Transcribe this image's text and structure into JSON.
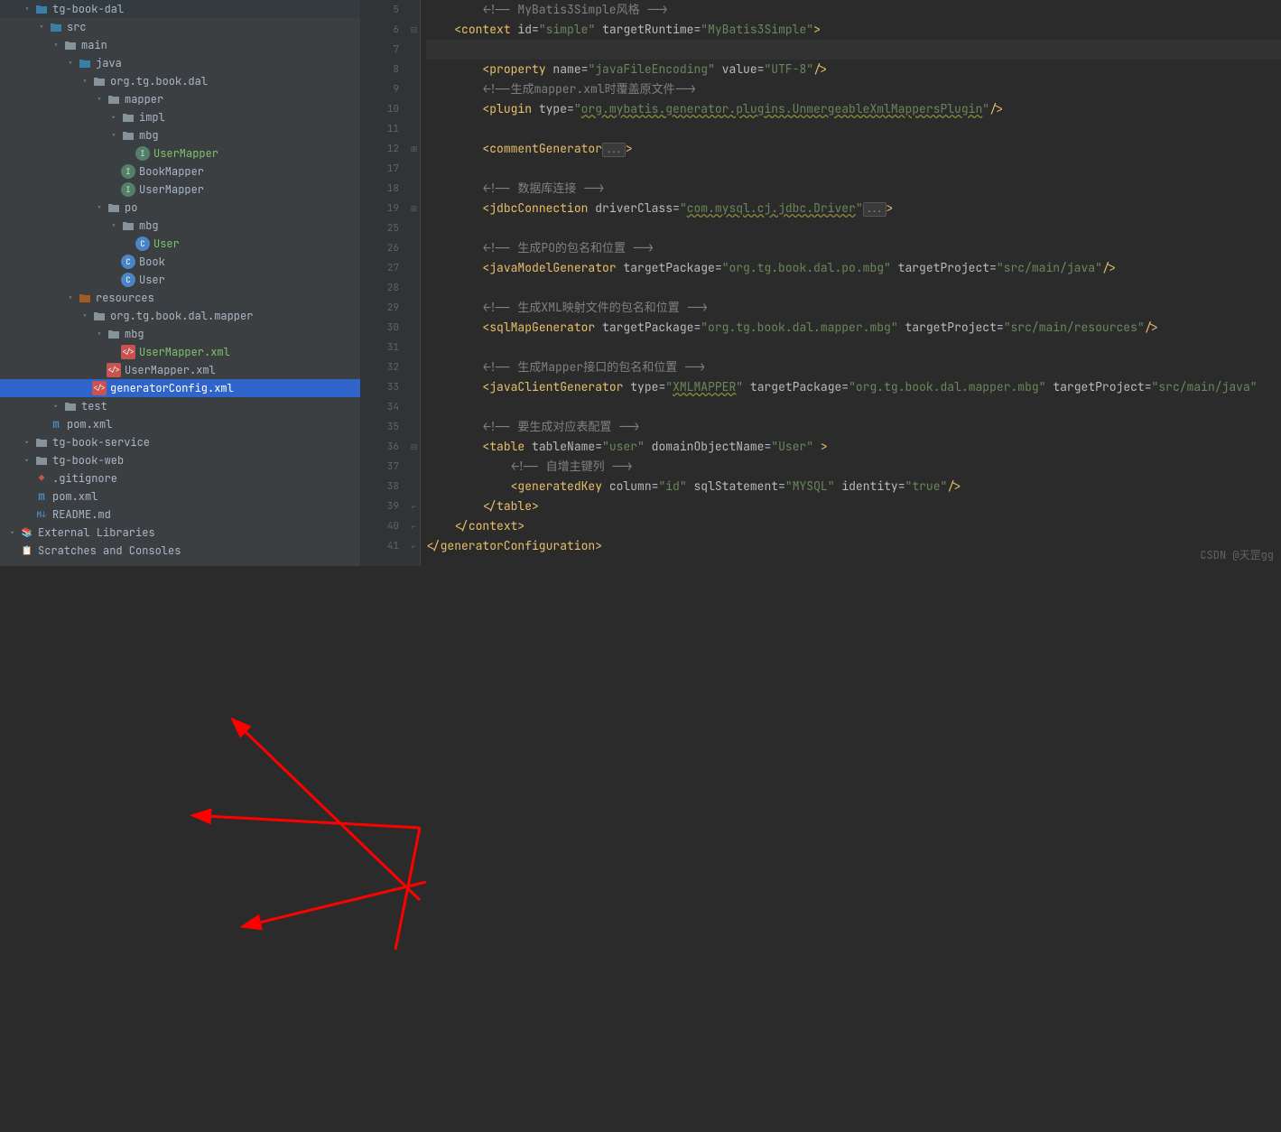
{
  "tree": [
    {
      "depth": 1,
      "arrow": "down",
      "icon": "folder-src",
      "label": "tg-book-dal",
      "cls": ""
    },
    {
      "depth": 2,
      "arrow": "down",
      "icon": "folder-src",
      "label": "src",
      "cls": ""
    },
    {
      "depth": 3,
      "arrow": "down",
      "icon": "folder",
      "label": "main",
      "cls": ""
    },
    {
      "depth": 4,
      "arrow": "down",
      "icon": "folder-src",
      "label": "java",
      "cls": ""
    },
    {
      "depth": 5,
      "arrow": "down",
      "icon": "folder-pkg",
      "label": "org.tg.book.dal",
      "cls": ""
    },
    {
      "depth": 6,
      "arrow": "down",
      "icon": "folder-pkg",
      "label": "mapper",
      "cls": ""
    },
    {
      "depth": 7,
      "arrow": "right",
      "icon": "folder-pkg",
      "label": "impl",
      "cls": ""
    },
    {
      "depth": 7,
      "arrow": "down",
      "icon": "folder-pkg",
      "label": "mbg",
      "cls": ""
    },
    {
      "depth": 8,
      "arrow": "none",
      "icon": "int",
      "label": "UserMapper",
      "cls": "green-text"
    },
    {
      "depth": 7,
      "arrow": "none",
      "icon": "int",
      "label": "BookMapper",
      "cls": ""
    },
    {
      "depth": 7,
      "arrow": "none",
      "icon": "int",
      "label": "UserMapper",
      "cls": ""
    },
    {
      "depth": 6,
      "arrow": "down",
      "icon": "folder-pkg",
      "label": "po",
      "cls": ""
    },
    {
      "depth": 7,
      "arrow": "down",
      "icon": "folder-pkg",
      "label": "mbg",
      "cls": ""
    },
    {
      "depth": 8,
      "arrow": "none",
      "icon": "java",
      "label": "User",
      "cls": "green-text"
    },
    {
      "depth": 7,
      "arrow": "none",
      "icon": "java",
      "label": "Book",
      "cls": ""
    },
    {
      "depth": 7,
      "arrow": "none",
      "icon": "java",
      "label": "User",
      "cls": ""
    },
    {
      "depth": 4,
      "arrow": "down",
      "icon": "folder-res",
      "label": "resources",
      "cls": ""
    },
    {
      "depth": 5,
      "arrow": "down",
      "icon": "folder-pkg",
      "label": "org.tg.book.dal.mapper",
      "cls": ""
    },
    {
      "depth": 6,
      "arrow": "down",
      "icon": "folder-pkg",
      "label": "mbg",
      "cls": ""
    },
    {
      "depth": 7,
      "arrow": "none",
      "icon": "xml",
      "label": "UserMapper.xml",
      "cls": "green-text"
    },
    {
      "depth": 6,
      "arrow": "none",
      "icon": "xml",
      "label": "UserMapper.xml",
      "cls": ""
    },
    {
      "depth": 5,
      "arrow": "none",
      "icon": "xml",
      "label": "generatorConfig.xml",
      "cls": "",
      "selected": true
    },
    {
      "depth": 3,
      "arrow": "right",
      "icon": "folder",
      "label": "test",
      "cls": ""
    },
    {
      "depth": 2,
      "arrow": "none",
      "icon": "maven",
      "label": "pom.xml",
      "cls": ""
    },
    {
      "depth": 1,
      "arrow": "right",
      "icon": "folder",
      "label": "tg-book-service",
      "cls": ""
    },
    {
      "depth": 1,
      "arrow": "right",
      "icon": "folder",
      "label": "tg-book-web",
      "cls": ""
    },
    {
      "depth": 1,
      "arrow": "none",
      "icon": "git",
      "label": ".gitignore",
      "cls": ""
    },
    {
      "depth": 1,
      "arrow": "none",
      "icon": "maven",
      "label": "pom.xml",
      "cls": ""
    },
    {
      "depth": 1,
      "arrow": "none",
      "icon": "md",
      "label": "README.md",
      "cls": ""
    },
    {
      "depth": 0,
      "arrow": "right",
      "icon": "lib",
      "label": "External Libraries",
      "cls": ""
    },
    {
      "depth": 0,
      "arrow": "none",
      "icon": "scratch",
      "label": "Scratches and Consoles",
      "cls": ""
    }
  ],
  "lines": [
    {
      "n": 5,
      "fold": "",
      "tokens": [
        {
          "t": "        ",
          "c": ""
        },
        {
          "t": "<!-- MyBatis3Simple风格 -->",
          "c": "c-comment"
        }
      ]
    },
    {
      "n": 6,
      "fold": "open",
      "bulb": true,
      "tokens": [
        {
          "t": "    ",
          "c": ""
        },
        {
          "t": "<",
          "c": "c-tag"
        },
        {
          "t": "context ",
          "c": "c-tag"
        },
        {
          "t": "id",
          "c": "c-attr"
        },
        {
          "t": "=",
          "c": "c-text"
        },
        {
          "t": "\"simple\"",
          "c": "c-str"
        },
        {
          "t": " ",
          "c": ""
        },
        {
          "t": "targetRuntime",
          "c": "c-attr"
        },
        {
          "t": "=",
          "c": "c-text"
        },
        {
          "t": "\"MyBatis3Simple\"",
          "c": "c-str"
        },
        {
          "t": ">",
          "c": "c-tag"
        }
      ]
    },
    {
      "n": 7,
      "fold": "",
      "cur": true,
      "tokens": [
        {
          "t": "",
          "c": ""
        }
      ]
    },
    {
      "n": 8,
      "fold": "",
      "tokens": [
        {
          "t": "        ",
          "c": ""
        },
        {
          "t": "<",
          "c": "c-tag"
        },
        {
          "t": "property ",
          "c": "c-tag"
        },
        {
          "t": "name",
          "c": "c-attr"
        },
        {
          "t": "=",
          "c": "c-text"
        },
        {
          "t": "\"javaFileEncoding\"",
          "c": "c-str"
        },
        {
          "t": " ",
          "c": ""
        },
        {
          "t": "value",
          "c": "c-attr"
        },
        {
          "t": "=",
          "c": "c-text"
        },
        {
          "t": "\"UTF-8\"",
          "c": "c-str"
        },
        {
          "t": "/>",
          "c": "c-tag"
        }
      ]
    },
    {
      "n": 9,
      "fold": "",
      "tokens": [
        {
          "t": "        ",
          "c": ""
        },
        {
          "t": "<!--生成mapper.xml时覆盖原文件-->",
          "c": "c-comment"
        }
      ]
    },
    {
      "n": 10,
      "fold": "",
      "tokens": [
        {
          "t": "        ",
          "c": ""
        },
        {
          "t": "<",
          "c": "c-tag"
        },
        {
          "t": "plugin ",
          "c": "c-tag"
        },
        {
          "t": "type",
          "c": "c-attr"
        },
        {
          "t": "=",
          "c": "c-text"
        },
        {
          "t": "\"",
          "c": "c-str"
        },
        {
          "t": "org.mybatis.generator.plugins.UnmergeableXmlMappersPlugin",
          "c": "c-str c-warn"
        },
        {
          "t": "\"",
          "c": "c-str"
        },
        {
          "t": "/>",
          "c": "c-tag"
        }
      ]
    },
    {
      "n": 11,
      "fold": "",
      "tokens": [
        {
          "t": "",
          "c": ""
        }
      ]
    },
    {
      "n": 12,
      "fold": "closed",
      "tokens": [
        {
          "t": "        ",
          "c": ""
        },
        {
          "t": "<",
          "c": "c-tag"
        },
        {
          "t": "commentGenerator",
          "c": "c-tag"
        },
        {
          "t": "...",
          "c": "c-fold"
        },
        {
          "t": ">",
          "c": "c-tag"
        }
      ]
    },
    {
      "n": 17,
      "fold": "",
      "tokens": [
        {
          "t": "",
          "c": ""
        }
      ]
    },
    {
      "n": 18,
      "fold": "",
      "tokens": [
        {
          "t": "        ",
          "c": ""
        },
        {
          "t": "<!-- 数据库连接 -->",
          "c": "c-comment"
        }
      ]
    },
    {
      "n": 19,
      "fold": "closed",
      "tokens": [
        {
          "t": "        ",
          "c": ""
        },
        {
          "t": "<",
          "c": "c-tag"
        },
        {
          "t": "jdbcConnection ",
          "c": "c-tag"
        },
        {
          "t": "driverClass",
          "c": "c-attr"
        },
        {
          "t": "=",
          "c": "c-text"
        },
        {
          "t": "\"",
          "c": "c-str"
        },
        {
          "t": "com.mysql.cj.jdbc.Driver",
          "c": "c-str c-warn"
        },
        {
          "t": "\"",
          "c": "c-str"
        },
        {
          "t": "...",
          "c": "c-fold"
        },
        {
          "t": ">",
          "c": "c-tag"
        }
      ]
    },
    {
      "n": 25,
      "fold": "",
      "tokens": [
        {
          "t": "",
          "c": ""
        }
      ]
    },
    {
      "n": 26,
      "fold": "",
      "tokens": [
        {
          "t": "        ",
          "c": ""
        },
        {
          "t": "<!-- 生成PO的包名和位置 -->",
          "c": "c-comment"
        }
      ]
    },
    {
      "n": 27,
      "fold": "",
      "tokens": [
        {
          "t": "        ",
          "c": ""
        },
        {
          "t": "<",
          "c": "c-tag"
        },
        {
          "t": "javaModelGenerator ",
          "c": "c-tag"
        },
        {
          "t": "targetPackage",
          "c": "c-attr"
        },
        {
          "t": "=",
          "c": "c-text"
        },
        {
          "t": "\"org.tg.book.dal.po.mbg\"",
          "c": "c-str"
        },
        {
          "t": " ",
          "c": ""
        },
        {
          "t": "targetProject",
          "c": "c-attr"
        },
        {
          "t": "=",
          "c": "c-text"
        },
        {
          "t": "\"src/main/java\"",
          "c": "c-str"
        },
        {
          "t": "/>",
          "c": "c-tag"
        }
      ]
    },
    {
      "n": 28,
      "fold": "",
      "tokens": [
        {
          "t": "",
          "c": ""
        }
      ]
    },
    {
      "n": 29,
      "fold": "",
      "tokens": [
        {
          "t": "        ",
          "c": ""
        },
        {
          "t": "<!-- 生成XML映射文件的包名和位置 -->",
          "c": "c-comment"
        }
      ]
    },
    {
      "n": 30,
      "fold": "",
      "tokens": [
        {
          "t": "        ",
          "c": ""
        },
        {
          "t": "<",
          "c": "c-tag"
        },
        {
          "t": "sqlMapGenerator ",
          "c": "c-tag"
        },
        {
          "t": "targetPackage",
          "c": "c-attr"
        },
        {
          "t": "=",
          "c": "c-text"
        },
        {
          "t": "\"org.tg.book.dal.mapper.mbg\"",
          "c": "c-str"
        },
        {
          "t": " ",
          "c": ""
        },
        {
          "t": "targetProject",
          "c": "c-attr"
        },
        {
          "t": "=",
          "c": "c-text"
        },
        {
          "t": "\"src/main/resources\"",
          "c": "c-str"
        },
        {
          "t": "/>",
          "c": "c-tag"
        }
      ]
    },
    {
      "n": 31,
      "fold": "",
      "tokens": [
        {
          "t": "",
          "c": ""
        }
      ]
    },
    {
      "n": 32,
      "fold": "",
      "tokens": [
        {
          "t": "        ",
          "c": ""
        },
        {
          "t": "<!-- 生成Mapper接口的包名和位置 -->",
          "c": "c-comment"
        }
      ]
    },
    {
      "n": 33,
      "fold": "",
      "tokens": [
        {
          "t": "        ",
          "c": ""
        },
        {
          "t": "<",
          "c": "c-tag"
        },
        {
          "t": "javaClientGenerator ",
          "c": "c-tag"
        },
        {
          "t": "type",
          "c": "c-attr"
        },
        {
          "t": "=",
          "c": "c-text"
        },
        {
          "t": "\"",
          "c": "c-str"
        },
        {
          "t": "XMLMAPPER",
          "c": "c-str c-warn"
        },
        {
          "t": "\"",
          "c": "c-str"
        },
        {
          "t": " ",
          "c": ""
        },
        {
          "t": "targetPackage",
          "c": "c-attr"
        },
        {
          "t": "=",
          "c": "c-text"
        },
        {
          "t": "\"org.tg.book.dal.mapper.mbg\"",
          "c": "c-str"
        },
        {
          "t": " ",
          "c": ""
        },
        {
          "t": "targetProject",
          "c": "c-attr"
        },
        {
          "t": "=",
          "c": "c-text"
        },
        {
          "t": "\"src/main/java\"",
          "c": "c-str"
        }
      ]
    },
    {
      "n": 34,
      "fold": "",
      "tokens": [
        {
          "t": "",
          "c": ""
        }
      ]
    },
    {
      "n": 35,
      "fold": "",
      "tokens": [
        {
          "t": "        ",
          "c": ""
        },
        {
          "t": "<!-- 要生成对应表配置 -->",
          "c": "c-comment"
        }
      ]
    },
    {
      "n": 36,
      "fold": "open",
      "tokens": [
        {
          "t": "        ",
          "c": ""
        },
        {
          "t": "<",
          "c": "c-tag"
        },
        {
          "t": "table ",
          "c": "c-tag"
        },
        {
          "t": "tableName",
          "c": "c-attr"
        },
        {
          "t": "=",
          "c": "c-text"
        },
        {
          "t": "\"user\"",
          "c": "c-str"
        },
        {
          "t": " ",
          "c": ""
        },
        {
          "t": "domainObjectName",
          "c": "c-attr"
        },
        {
          "t": "=",
          "c": "c-text"
        },
        {
          "t": "\"User\"",
          "c": "c-str"
        },
        {
          "t": " >",
          "c": "c-tag"
        }
      ]
    },
    {
      "n": 37,
      "fold": "",
      "tokens": [
        {
          "t": "            ",
          "c": ""
        },
        {
          "t": "<!-- 自增主键列 -->",
          "c": "c-comment"
        }
      ]
    },
    {
      "n": 38,
      "fold": "",
      "tokens": [
        {
          "t": "            ",
          "c": ""
        },
        {
          "t": "<",
          "c": "c-tag"
        },
        {
          "t": "generatedKey ",
          "c": "c-tag"
        },
        {
          "t": "column",
          "c": "c-attr"
        },
        {
          "t": "=",
          "c": "c-text"
        },
        {
          "t": "\"id\"",
          "c": "c-str"
        },
        {
          "t": " ",
          "c": ""
        },
        {
          "t": "sqlStatement",
          "c": "c-attr"
        },
        {
          "t": "=",
          "c": "c-text"
        },
        {
          "t": "\"MYSQL\"",
          "c": "c-str"
        },
        {
          "t": " ",
          "c": ""
        },
        {
          "t": "identity",
          "c": "c-attr"
        },
        {
          "t": "=",
          "c": "c-text"
        },
        {
          "t": "\"true\"",
          "c": "c-str"
        },
        {
          "t": "/>",
          "c": "c-tag"
        }
      ]
    },
    {
      "n": 39,
      "fold": "close",
      "tokens": [
        {
          "t": "        ",
          "c": ""
        },
        {
          "t": "</",
          "c": "c-tag"
        },
        {
          "t": "table",
          "c": "c-tag"
        },
        {
          "t": ">",
          "c": "c-tag"
        }
      ]
    },
    {
      "n": 40,
      "fold": "close",
      "tokens": [
        {
          "t": "    ",
          "c": ""
        },
        {
          "t": "</",
          "c": "c-tag"
        },
        {
          "t": "context",
          "c": "c-tag"
        },
        {
          "t": ">",
          "c": "c-tag"
        }
      ]
    },
    {
      "n": 41,
      "fold": "close",
      "tokens": [
        {
          "t": "</",
          "c": "c-tag"
        },
        {
          "t": "generatorConfiguration",
          "c": "c-tag"
        },
        {
          "t": ">",
          "c": "c-tag"
        }
      ]
    }
  ],
  "watermark": "CSDN @天罡gg"
}
